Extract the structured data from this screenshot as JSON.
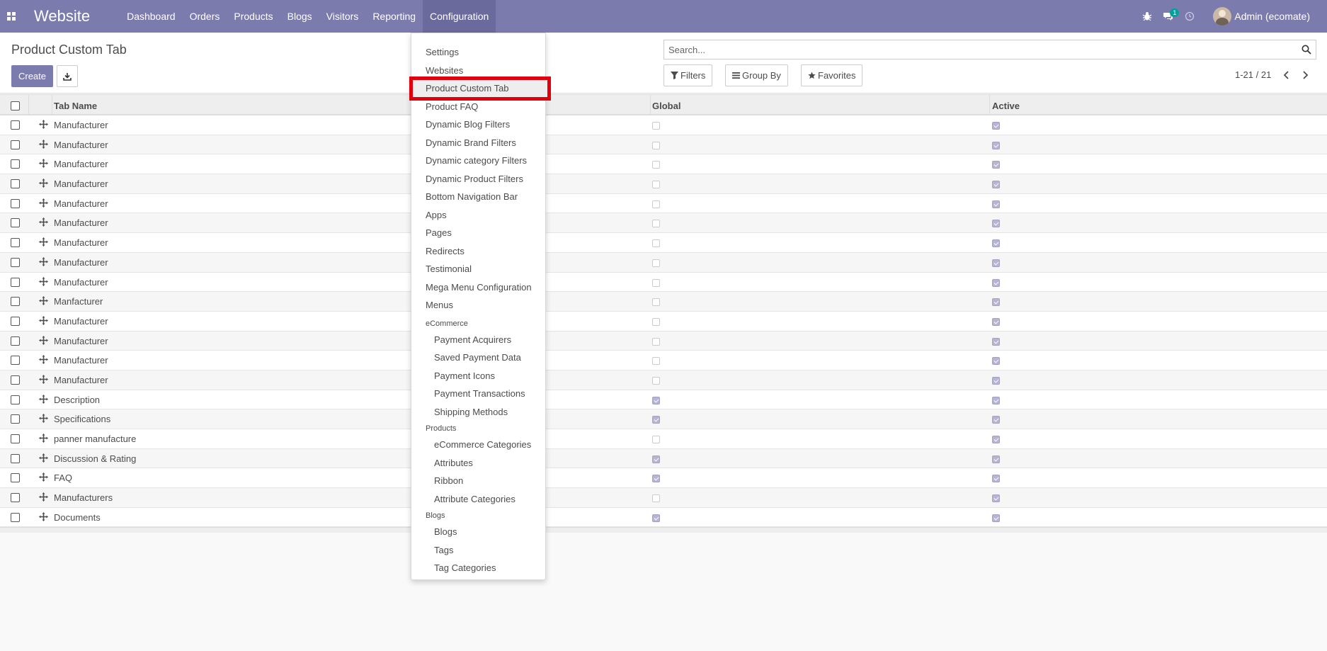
{
  "navbar": {
    "brand": "Website",
    "menu": [
      "Dashboard",
      "Orders",
      "Products",
      "Blogs",
      "Visitors",
      "Reporting",
      "Configuration"
    ],
    "active_menu": "Configuration",
    "chat_badge": "1",
    "user_name": "Admin (ecomate)"
  },
  "control_panel": {
    "title": "Product Custom Tab",
    "create_label": "Create",
    "search_placeholder": "Search...",
    "filters_label": "Filters",
    "groupby_label": "Group By",
    "favorites_label": "Favorites",
    "pager": "1-21 / 21"
  },
  "table": {
    "columns": [
      "Tab Name",
      "Global",
      "Active"
    ],
    "rows": [
      {
        "name": "Manufacturer",
        "global": false,
        "active": true
      },
      {
        "name": "Manufacturer",
        "global": false,
        "active": true
      },
      {
        "name": "Manufacturer",
        "global": false,
        "active": true
      },
      {
        "name": "Manufacturer",
        "global": false,
        "active": true
      },
      {
        "name": "Manufacturer",
        "global": false,
        "active": true
      },
      {
        "name": "Manufacturer",
        "global": false,
        "active": true
      },
      {
        "name": "Manufacturer",
        "global": false,
        "active": true
      },
      {
        "name": "Manufacturer",
        "global": false,
        "active": true
      },
      {
        "name": "Manufacturer",
        "global": false,
        "active": true
      },
      {
        "name": "Manfacturer",
        "global": false,
        "active": true
      },
      {
        "name": "Manufacturer",
        "global": false,
        "active": true
      },
      {
        "name": "Manufacturer",
        "global": false,
        "active": true
      },
      {
        "name": "Manufacturer",
        "global": false,
        "active": true
      },
      {
        "name": "Manufacturer",
        "global": false,
        "active": true
      },
      {
        "name": "Description",
        "global": true,
        "active": true
      },
      {
        "name": "Specifications",
        "global": true,
        "active": true
      },
      {
        "name": "panner manufacture",
        "global": false,
        "active": true
      },
      {
        "name": "Discussion & Rating",
        "global": true,
        "active": true
      },
      {
        "name": "FAQ",
        "global": true,
        "active": true
      },
      {
        "name": "Manufacturers",
        "global": false,
        "active": true
      },
      {
        "name": "Documents",
        "global": true,
        "active": true
      }
    ]
  },
  "dropdown": {
    "items": [
      {
        "type": "item",
        "label": "Settings"
      },
      {
        "type": "item",
        "label": "Websites"
      },
      {
        "type": "item",
        "label": "Product Custom Tab",
        "highlighted": true
      },
      {
        "type": "item",
        "label": "Product FAQ"
      },
      {
        "type": "item",
        "label": "Dynamic Blog Filters"
      },
      {
        "type": "item",
        "label": "Dynamic Brand Filters"
      },
      {
        "type": "item",
        "label": "Dynamic category Filters"
      },
      {
        "type": "item",
        "label": "Dynamic Product Filters"
      },
      {
        "type": "item",
        "label": "Bottom Navigation Bar"
      },
      {
        "type": "item",
        "label": "Apps"
      },
      {
        "type": "item",
        "label": "Pages"
      },
      {
        "type": "item",
        "label": "Redirects"
      },
      {
        "type": "item",
        "label": "Testimonial"
      },
      {
        "type": "item",
        "label": "Mega Menu Configuration"
      },
      {
        "type": "item",
        "label": "Menus"
      },
      {
        "type": "header",
        "label": "eCommerce"
      },
      {
        "type": "sub",
        "label": "Payment Acquirers"
      },
      {
        "type": "sub",
        "label": "Saved Payment Data"
      },
      {
        "type": "sub",
        "label": "Payment Icons"
      },
      {
        "type": "sub",
        "label": "Payment Transactions"
      },
      {
        "type": "sub",
        "label": "Shipping Methods"
      },
      {
        "type": "header",
        "label": "Products"
      },
      {
        "type": "sub",
        "label": "eCommerce Categories"
      },
      {
        "type": "sub",
        "label": "Attributes"
      },
      {
        "type": "sub",
        "label": "Ribbon"
      },
      {
        "type": "sub",
        "label": "Attribute Categories"
      },
      {
        "type": "header",
        "label": "Blogs"
      },
      {
        "type": "sub",
        "label": "Blogs"
      },
      {
        "type": "sub",
        "label": "Tags"
      },
      {
        "type": "sub",
        "label": "Tag Categories"
      }
    ]
  },
  "colors": {
    "primary": "#7c7bad",
    "highlight_border": "#e0000e",
    "badge": "#00a09d"
  }
}
